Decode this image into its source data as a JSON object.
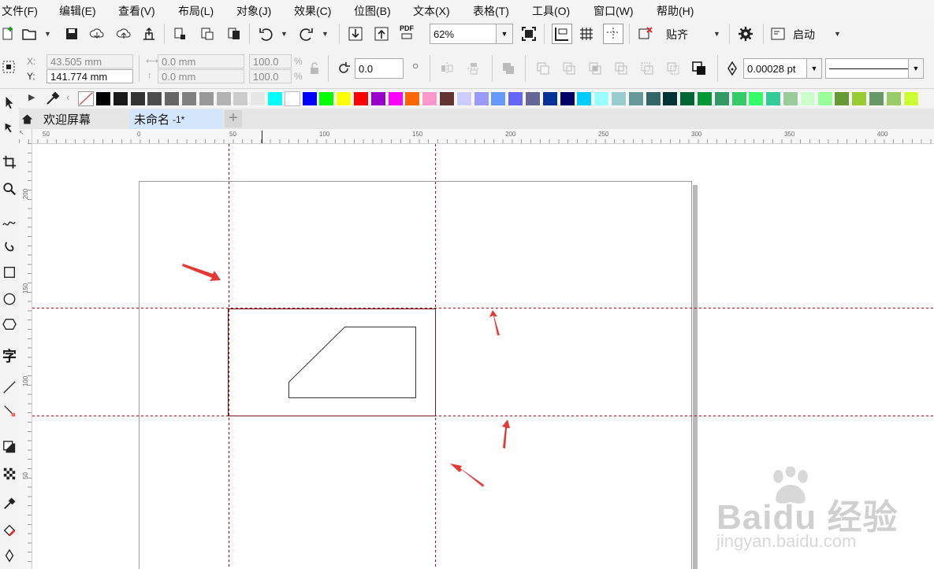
{
  "menu": [
    "文件(F)",
    "编辑(E)",
    "查看(V)",
    "布局(L)",
    "对象(J)",
    "效果(C)",
    "位图(B)",
    "文本(X)",
    "表格(T)",
    "工具(O)",
    "窗口(W)",
    "帮助(H)"
  ],
  "toolbar": {
    "zoom_value": "62%",
    "snap_label": "贴齐",
    "launch_label": "启动",
    "pdf_label": "PDF"
  },
  "properties": {
    "x_label": "X:",
    "y_label": "Y:",
    "x_value": "43.505 mm",
    "y_value": "141.774 mm",
    "w_value": "0.0 mm",
    "h_value": "0.0 mm",
    "scale_x": "100.0",
    "scale_y": "100.0",
    "percent": "%",
    "rotation": "0.0",
    "outline_width": "0.00028 pt"
  },
  "tabs": {
    "welcome": "欢迎屏幕",
    "document": "未命名",
    "document_suffix": "-1*",
    "add": "+"
  },
  "ruler": {
    "h_labels": [
      "50",
      "0",
      "50",
      "100",
      "150",
      "200",
      "250",
      "300",
      "350",
      "400"
    ],
    "v_labels": [
      "200",
      "150",
      "100",
      "50"
    ]
  },
  "palette": [
    "#000000",
    "#1a1a1a",
    "#333333",
    "#4d4d4d",
    "#666666",
    "#808080",
    "#999999",
    "#b3b3b3",
    "#cccccc",
    "#e6e6e6",
    "#00ffff",
    "#ffffff",
    "#0000ff",
    "#00ff00",
    "#ffff00",
    "#ff0000",
    "#9900cc",
    "#ff00ff",
    "#ff6600",
    "#ff99cc",
    "#663333",
    "#ccccff",
    "#9999ff",
    "#6699ff",
    "#6666ff",
    "#666699",
    "#003399",
    "#000066",
    "#00ccff",
    "#99ffff",
    "#99cccc",
    "#669999",
    "#336666",
    "#003333",
    "#006633",
    "#009933",
    "#339966",
    "#33cc66",
    "#33ff66",
    "#33cc99",
    "#99cc99",
    "#ccffcc",
    "#99ff99",
    "#669933",
    "#99cc33",
    "#669966",
    "#99cc66",
    "#ccff33"
  ],
  "watermark": {
    "brand": "Baidu 经验",
    "url": "jingyan.baidu.com"
  },
  "colors": {
    "guide": "#cc0000",
    "arrow": "#e53935",
    "accent": "#1a7fd4"
  }
}
